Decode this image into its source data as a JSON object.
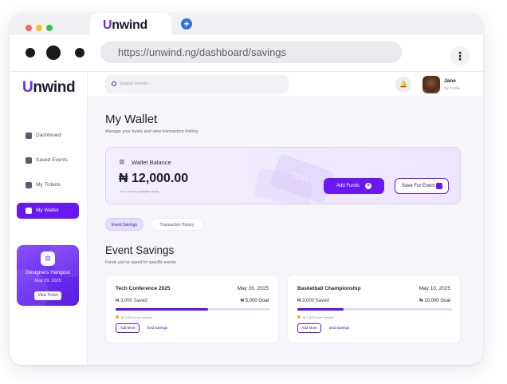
{
  "browser": {
    "tab_logo_u": "U",
    "tab_logo_rest": "nwind",
    "newtab_icon": "+",
    "url": "https://unwind.ng/dashboard/savings",
    "menu_icon": "⋮"
  },
  "sidebar": {
    "brand_u": "U",
    "brand_rest": "nwind",
    "items": [
      {
        "label": "Dashboard",
        "icon": "home-icon"
      },
      {
        "label": "Saved Events",
        "icon": "folder-icon"
      },
      {
        "label": "My Tickets",
        "icon": "ticket-icon"
      },
      {
        "label": "My Wallet",
        "icon": "wallet-icon",
        "active": true
      }
    ],
    "promo": {
      "title": "Designers Hangout",
      "date": "May 29, 2025",
      "button": "View Ticket"
    }
  },
  "topbar": {
    "search_placeholder": "Search events...",
    "user_name": "Jane",
    "user_sub": "My Profile"
  },
  "wallet": {
    "title": "My Wallet",
    "subtitle": "Manage your funds and view transaction history.",
    "balance_label": "Wallet Balance",
    "balance_amount": "₦ 12,000.00",
    "balance_note": "Your current available funds",
    "add_funds": "Add Funds",
    "save_for_event": "Save For Event",
    "ticket_art_text": "TICKET"
  },
  "tabs": {
    "active": "Event Savings",
    "inactive": "Transaction History"
  },
  "savings": {
    "title": "Event Savings",
    "subtitle": "Funds you've saved for specific events",
    "cards": [
      {
        "title": "Tech Conference 2025",
        "date": "May 26, 2025",
        "saved": "₦ 3,000 Saved",
        "goal": "₦ 5,000 Goal",
        "progress": 0.6,
        "needed": "₦ 2,000 more needed",
        "add_more": "Add More",
        "end": "End Savings"
      },
      {
        "title": "Basketball Championship",
        "date": "May 10, 2025",
        "saved": "₦ 3,000 Saved",
        "goal": "₦ 10,000 Goal",
        "progress": 0.3,
        "needed": "₦ 7,000 more needed",
        "add_more": "Add More",
        "end": "End Savings"
      }
    ]
  },
  "colors": {
    "accent": "#6a18f0",
    "accent_light": "#ede6ff",
    "warning": "#f2b22a"
  }
}
